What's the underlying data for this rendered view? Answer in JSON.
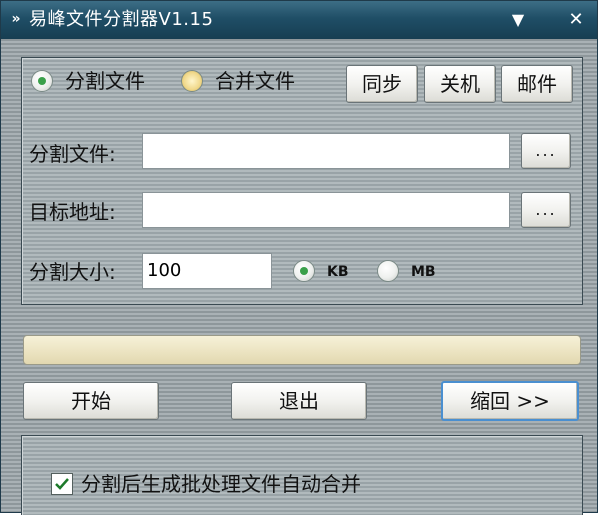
{
  "window": {
    "title": "易峰文件分割器V1.15"
  },
  "mode": {
    "split_label": "分割文件",
    "merge_label": "合并文件",
    "selected": "split"
  },
  "top_buttons": {
    "sync": "同步",
    "shutdown": "关机",
    "mail": "邮件"
  },
  "fields": {
    "split_file_label": "分割文件:",
    "split_file_value": "",
    "target_label": "目标地址:",
    "target_value": "",
    "size_label": "分割大小:",
    "size_value": "100",
    "browse": "..."
  },
  "units": {
    "kb": "KB",
    "mb": "MB",
    "selected": "KB"
  },
  "progress": {
    "value": 0
  },
  "actions": {
    "start": "开始",
    "exit": "退出",
    "collapse": "缩回 >>"
  },
  "options": {
    "auto_merge_label": "分割后生成批处理文件自动合并",
    "auto_merge_checked": true
  }
}
